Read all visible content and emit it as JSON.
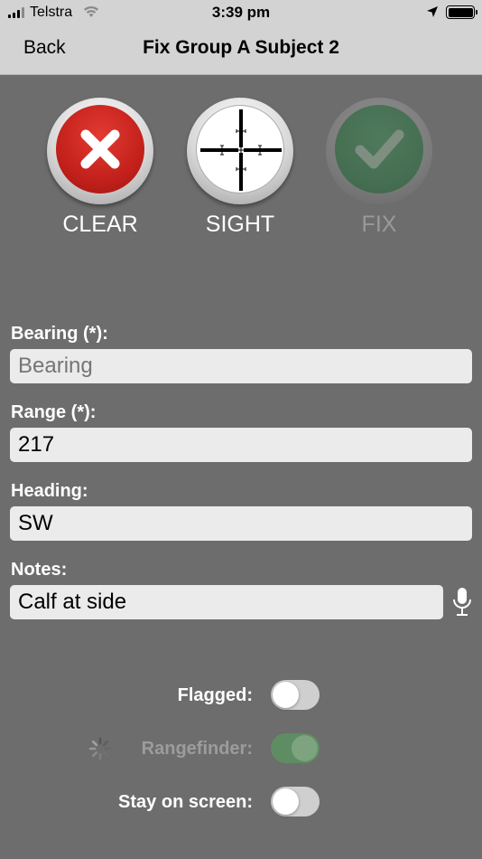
{
  "status_bar": {
    "carrier": "Telstra",
    "time": "3:39 pm",
    "signal_bars": 4,
    "signal_strength": 3,
    "battery_level": 1.0
  },
  "nav": {
    "back_label": "Back",
    "title": "Fix Group A Subject 2"
  },
  "actions": {
    "clear_label": "CLEAR",
    "sight_label": "SIGHT",
    "fix_label": "FIX"
  },
  "form": {
    "bearing_label": "Bearing (*):",
    "bearing_value": "",
    "bearing_placeholder": "Bearing",
    "range_label": "Range (*):",
    "range_value": "217",
    "heading_label": "Heading:",
    "heading_value": "SW",
    "notes_label": "Notes:",
    "notes_value": "Calf at side"
  },
  "toggles": {
    "flagged_label": "Flagged:",
    "flagged_on": false,
    "rangefinder_label": "Rangefinder:",
    "rangefinder_on": true,
    "stay_label": "Stay on screen:",
    "stay_on": false
  },
  "colors": {
    "background": "#6d6d6d",
    "bar": "#d3d3d3",
    "clear_red": "#c4211c",
    "fix_green_disabled": "#456d51",
    "switch_on": "#5e8d63"
  },
  "icons": {
    "clear": "x-mark-icon",
    "sight": "crosshair-icon",
    "fix": "checkmark-icon",
    "notes": "microphone-icon",
    "rangefinder": "spinner-icon"
  }
}
